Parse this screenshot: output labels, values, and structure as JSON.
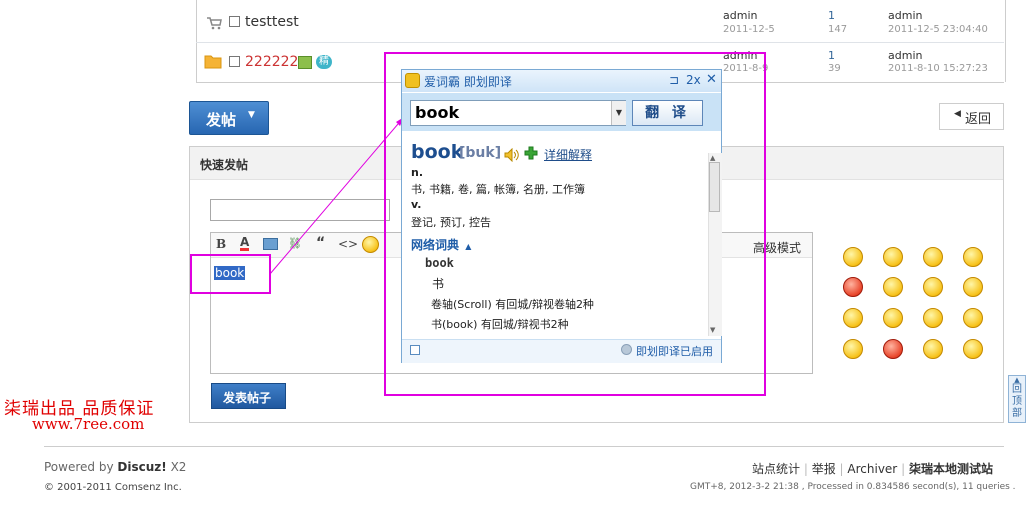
{
  "threads": [
    {
      "title": "testtest",
      "title_color": "#333333",
      "author": "admin",
      "date": "2011-12-5",
      "replies": "1",
      "views": "147",
      "last_user": "admin",
      "last_time": "2011-12-5 23:04:40"
    },
    {
      "title": "222222",
      "title_color": "#cc3333",
      "author": "admin",
      "date": "2011-8-9",
      "replies": "1",
      "views": "39",
      "last_user": "admin",
      "last_time": "2011-8-10 15:27:23",
      "badge": "精"
    }
  ],
  "buttons": {
    "post": "发帖",
    "back": "返回",
    "submit": "发表帖子"
  },
  "quick_post": {
    "title": "快速发帖",
    "advanced_mode": "高级模式",
    "editor_text": "book"
  },
  "toolbar_icons": [
    "B",
    "A",
    "image",
    "link",
    "quote",
    "code",
    "smiley"
  ],
  "dict": {
    "app": "爱词霸 即划即译",
    "controls": {
      "pin": "⊐",
      "size": "2x",
      "close": "✕"
    },
    "input_value": "book",
    "translate_button": "翻 译",
    "word": "book",
    "phonetic": "[buk]",
    "detail_link": "详细解释",
    "pos1": "n.",
    "def1": "书, 书籍, 卷, 篇, 帐簿, 名册, 工作簿",
    "pos2": "v.",
    "def2": "登记, 预订, 控告",
    "section": "网络词典",
    "entry_word": "book",
    "entry_meaning": "书",
    "line1": "卷轴(Scroll) 有回城/辩视卷轴2种",
    "line2": "书(book) 有回城/辩视书2种",
    "status": "即划即译已启用"
  },
  "back_to_top": "回顶部",
  "promo": {
    "line1": "柒瑞出品  品质保证",
    "line2": "www.7ree.com"
  },
  "footer": {
    "powered_prefix": "Powered by",
    "powered_brand": "Discuz!",
    "version": "X2",
    "copyright": "© 2001-2011 Comsenz Inc.",
    "links": [
      "站点统计",
      "举报",
      "Archiver"
    ],
    "site_name": "柒瑞本地测试站",
    "info": "GMT+8, 2012-3-2 21:38 , Processed in 0.834586 second(s), 11 queries ."
  },
  "colors": {
    "annotation": "#e000e0",
    "accent": "#2766b1",
    "promo": "#e00000"
  }
}
